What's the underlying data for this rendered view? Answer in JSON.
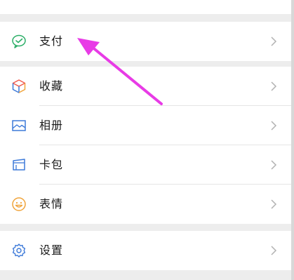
{
  "menu": {
    "pay": {
      "label": "支付",
      "icon": "wechat-pay-icon"
    },
    "favorites": {
      "label": "收藏",
      "icon": "cube-icon"
    },
    "album": {
      "label": "相册",
      "icon": "picture-icon"
    },
    "cards": {
      "label": "卡包",
      "icon": "card-wallet-icon"
    },
    "stickers": {
      "label": "表情",
      "icon": "smiley-icon"
    },
    "settings": {
      "label": "设置",
      "icon": "gear-icon"
    }
  },
  "colors": {
    "background": "#ededed",
    "cell": "#ffffff",
    "annotation_arrow": "#e83be6",
    "pay_green": "#2bae67",
    "album_blue": "#3d7ad9",
    "smiley_orange": "#f0a43b",
    "settings_blue": "#3d7ad9"
  }
}
